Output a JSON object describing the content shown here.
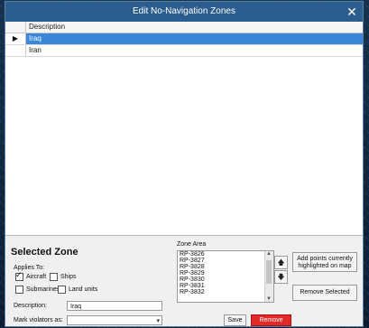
{
  "window": {
    "title": "Edit No-Navigation Zones",
    "close_glyph": "✕"
  },
  "grid": {
    "column_header": "Description",
    "selected_marker": "▶",
    "rows": [
      {
        "description": "Iraq",
        "selected": true
      },
      {
        "description": "Iran",
        "selected": false
      }
    ]
  },
  "panel": {
    "title": "Selected Zone",
    "applies_to_label": "Applies To:",
    "checkboxes": [
      {
        "label": "Aircraft",
        "checked": true
      },
      {
        "label": "Ships",
        "checked": false
      },
      {
        "label": "Submarines",
        "checked": false
      },
      {
        "label": "Land units",
        "checked": false
      }
    ],
    "description_label": "Description:",
    "description_value": "Iraq",
    "mark_violators_label": "Mark violators as:",
    "mark_violators_value": "",
    "zone_area_label": "Zone Area",
    "zone_area_items": [
      "RP-3826",
      "RP-3827",
      "RP-3828",
      "RP-3829",
      "RP-3830",
      "RP-3831",
      "RP-3832"
    ],
    "add_points_button": "Add points currently highlighted on map",
    "remove_selected_button": "Remove Selected",
    "save_button": "Save",
    "remove_button": "Remove",
    "move_up_glyph": "🡅",
    "move_down_glyph": "🡇"
  },
  "colors": {
    "titlebar": "#2b5d8e",
    "selection": "#3a86d8",
    "remove_button": "#e02a2a"
  }
}
